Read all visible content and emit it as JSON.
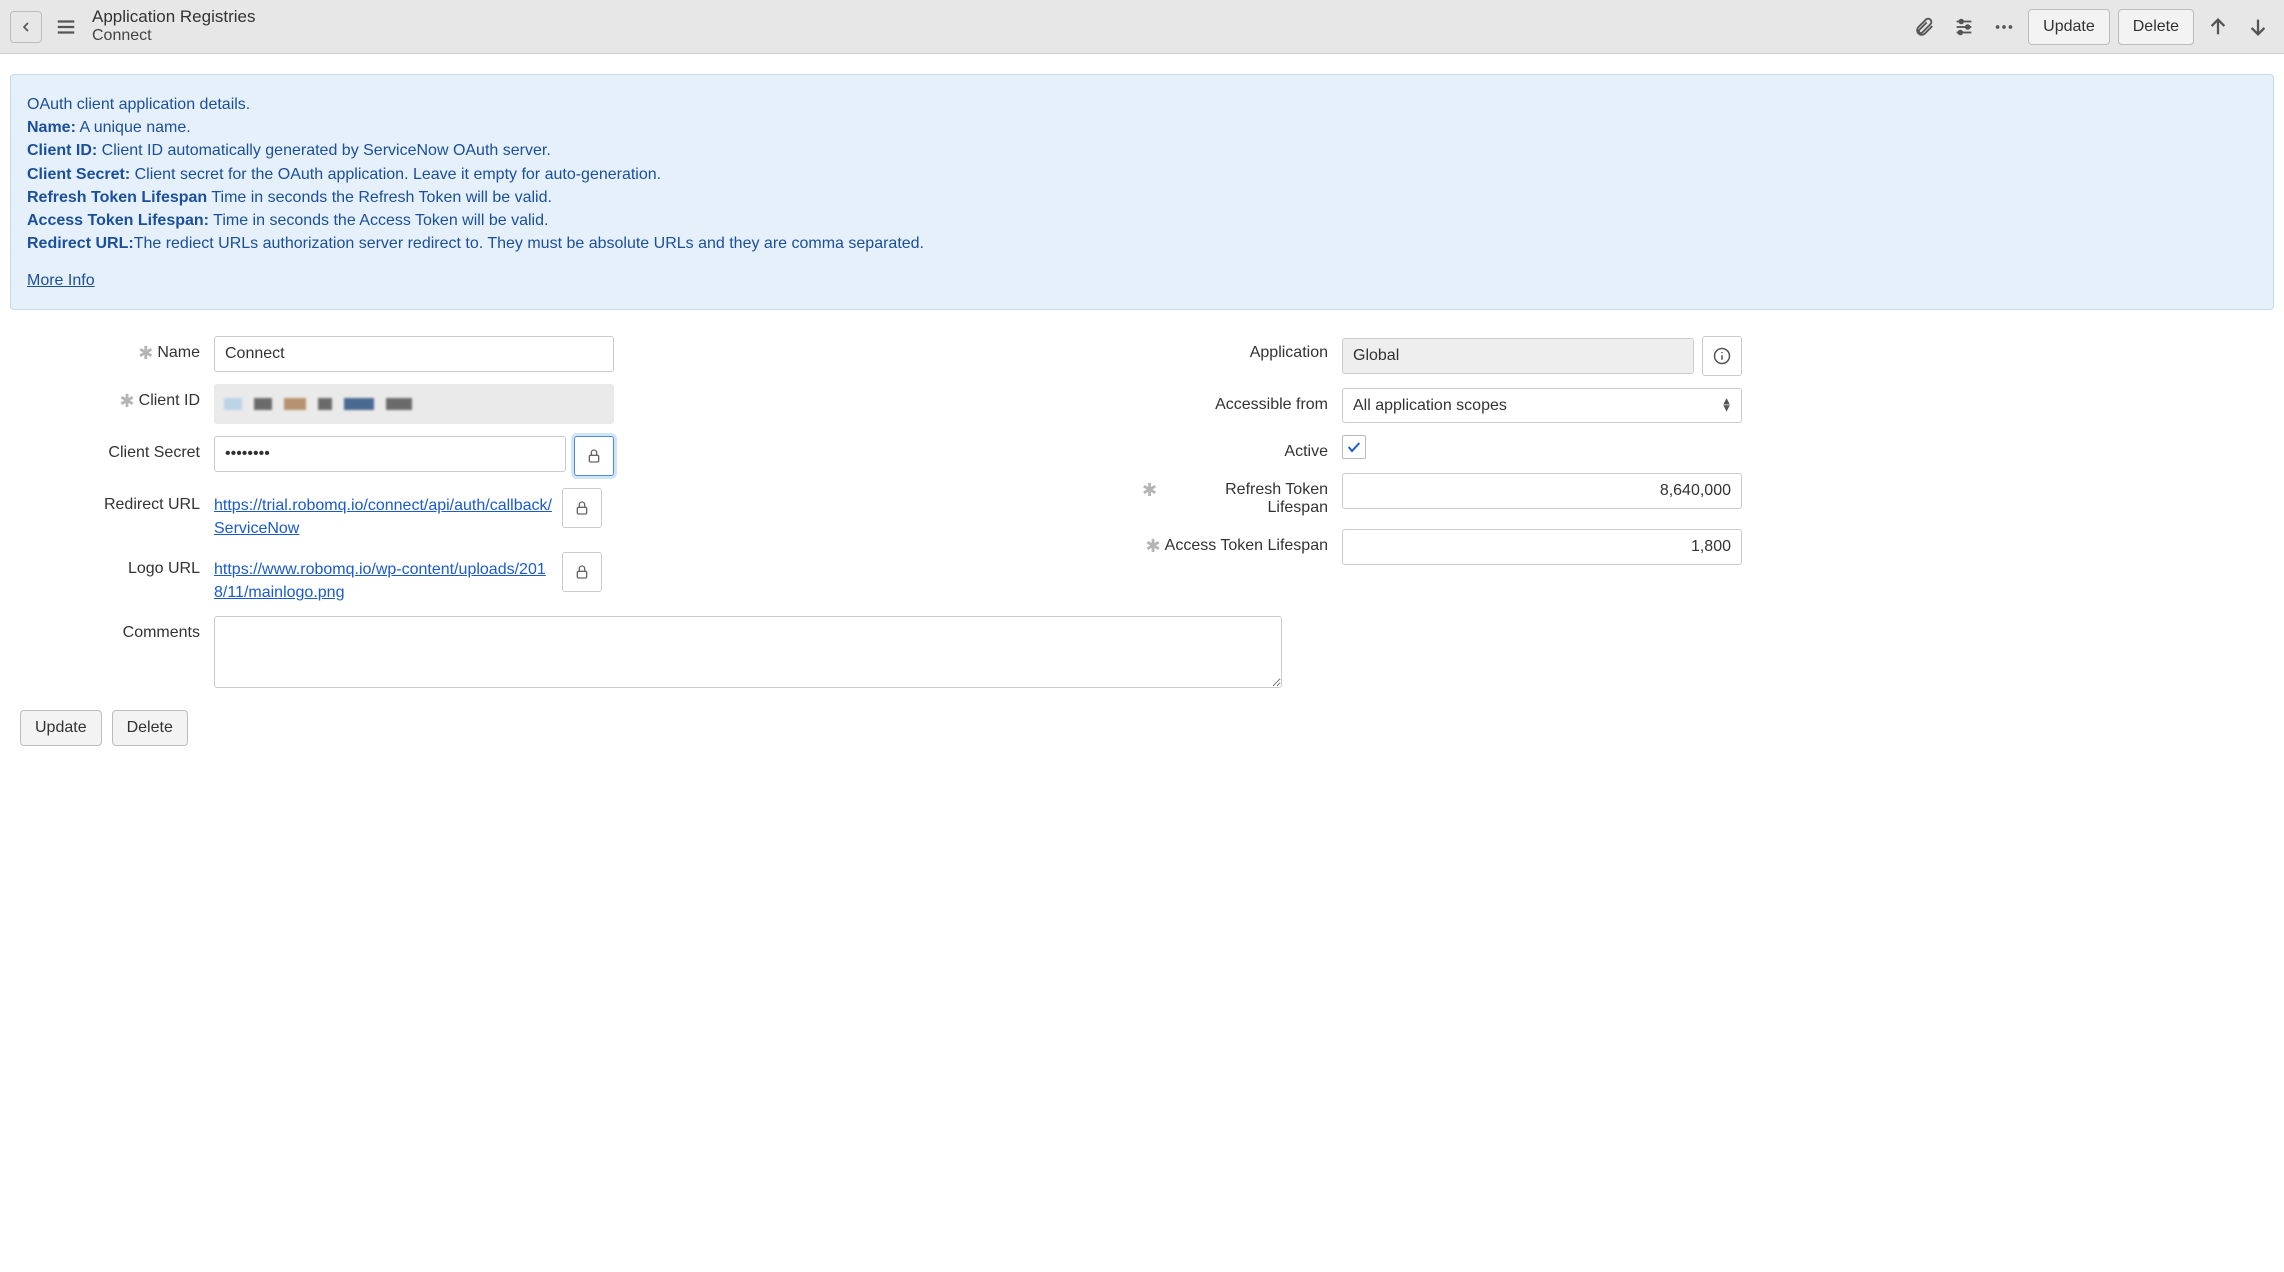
{
  "header": {
    "title": "Application Registries",
    "subtitle": "Connect",
    "update_label": "Update",
    "delete_label": "Delete"
  },
  "info": {
    "line0": "OAuth client application details.",
    "name_label": "Name:",
    "name_text": " A unique name.",
    "cid_label": "Client ID:",
    "cid_text": " Client ID automatically generated by ServiceNow OAuth server.",
    "csec_label": "Client Secret:",
    "csec_text": " Client secret for the OAuth application. Leave it empty for auto-generation.",
    "rtl_label": "Refresh Token Lifespan",
    "rtl_text": " Time in seconds the Refresh Token will be valid.",
    "atl_label": "Access Token Lifespan:",
    "atl_text": " Time in seconds the Access Token will be valid.",
    "rurl_label": "Redirect URL:",
    "rurl_text": "The rediect URLs authorization server redirect to. They must be absolute URLs and they are comma separated.",
    "more_info": "More Info"
  },
  "fields": {
    "name_label": "Name",
    "name_value": "Connect",
    "client_id_label": "Client ID",
    "client_secret_label": "Client Secret",
    "client_secret_value": "••••••••",
    "redirect_url_label": "Redirect URL",
    "redirect_url_value": "https://trial.robomq.io/connect/api/auth/callback/ServiceNow",
    "logo_url_label": "Logo URL",
    "logo_url_value": "https://www.robomq.io/wp-content/uploads/2018/11/mainlogo.png",
    "comments_label": "Comments",
    "comments_value": "",
    "application_label": "Application",
    "application_value": "Global",
    "accessible_from_label": "Accessible from",
    "accessible_from_value": "All application scopes",
    "active_label": "Active",
    "active_checked": true,
    "refresh_lifespan_label": "Refresh Token Lifespan",
    "refresh_lifespan_value": "8,640,000",
    "access_lifespan_label": "Access Token Lifespan",
    "access_lifespan_value": "1,800"
  },
  "footer": {
    "update_label": "Update",
    "delete_label": "Delete"
  }
}
